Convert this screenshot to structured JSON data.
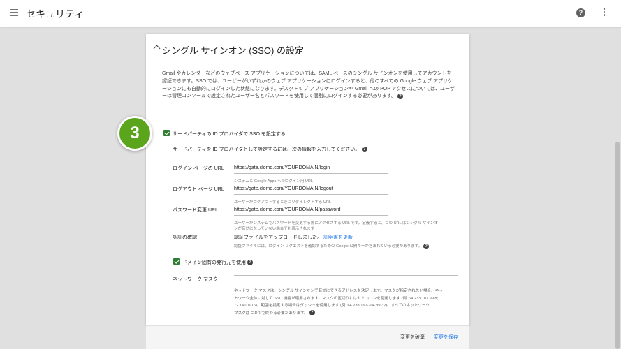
{
  "header": {
    "title": "セキュリティ",
    "menu_icon": "hamburger-menu-icon",
    "help_icon": "help-circle-icon",
    "more_icon": "more-vert-icon"
  },
  "card": {
    "title": "シングル サインオン (SSO) の設定",
    "description": "Gmail やカレンダーなどのウェブベース アプリケーションについては、SAML ベースのシングル サインオンを使用してアカウントを認証できます。SSO では、ユーザーがいずれかのウェブ アプリケーションにログインすると、他のすべての Google ウェブ アプリケーションにも自動的にログインした状態になります。デスクトップ アプリケーションや Gmail への POP アクセスについては、ユーザーは管理コンソールで設定されたユーザー名とパスワードを使用して個別にログインする必要があります。"
  },
  "step_badge": "3",
  "sso": {
    "checkbox_label": "サードパーティの ID プロバイダで SSO を設定する",
    "intro": "サードパーティを ID プロバイダとして設定するには、次の情報を入力してください。",
    "fields": [
      {
        "label": "ログイン ページの URL",
        "value": "https://gate.clomo.com/YOURDOMAIN/login",
        "hint": "システムと Google Apps へのログイン用 URL"
      },
      {
        "label": "ログアウト ページ URL",
        "value": "https://gate.clomo.com/YOURDOMAIN/logout",
        "hint": "ユーザーがログアウトするときにリダイレクトする URL"
      },
      {
        "label": "パスワード変更 URL",
        "value": "https://gate.clomo.com/YOURDOMAIN/password",
        "hint_line1": "ユーザーがシステムでパスワードを変更する際にアクセスする URL です。定義すると、この URL はシングル サインオ",
        "hint_line2": "ンが有効になっていない場合でも表示されます"
      }
    ],
    "cert": {
      "label": "認証の確認",
      "status": "認証ファイルをアップロードしました。",
      "link": "証明書を更新",
      "hint": "認証ファイルには、ログイン リクエストを確認するための Google 公開キーが含まれている必要があります。"
    },
    "domain_issuer_label": "ドメイン固有の発行元を使用",
    "netmask": {
      "label": "ネットワーク マスク",
      "line1": "ネットワーク マスクは、シングル サインオンで有効にできるアドレスを決定します。マスクが指定されない場合、ネッ",
      "line2": "トワーク全体に対して SSO 機能が適用されます。マスクの区切りにはセミコロンを使用します (例: 64.233.187.99/8;",
      "line3": "72.14.0.0/16)。範囲を指定する場合はダッシュを使用します (例: 64.233.167-204.99/32)。すべてのネットワーク",
      "line4": "マスクは CIDR で終わる必要があります。"
    }
  },
  "footer": {
    "discard": "変更を破棄",
    "save": "変更を保存"
  },
  "colors": {
    "accent_blue": "#1a73e8",
    "checkbox_green": "#2e7d32",
    "badge_green": "#5aa51c"
  }
}
